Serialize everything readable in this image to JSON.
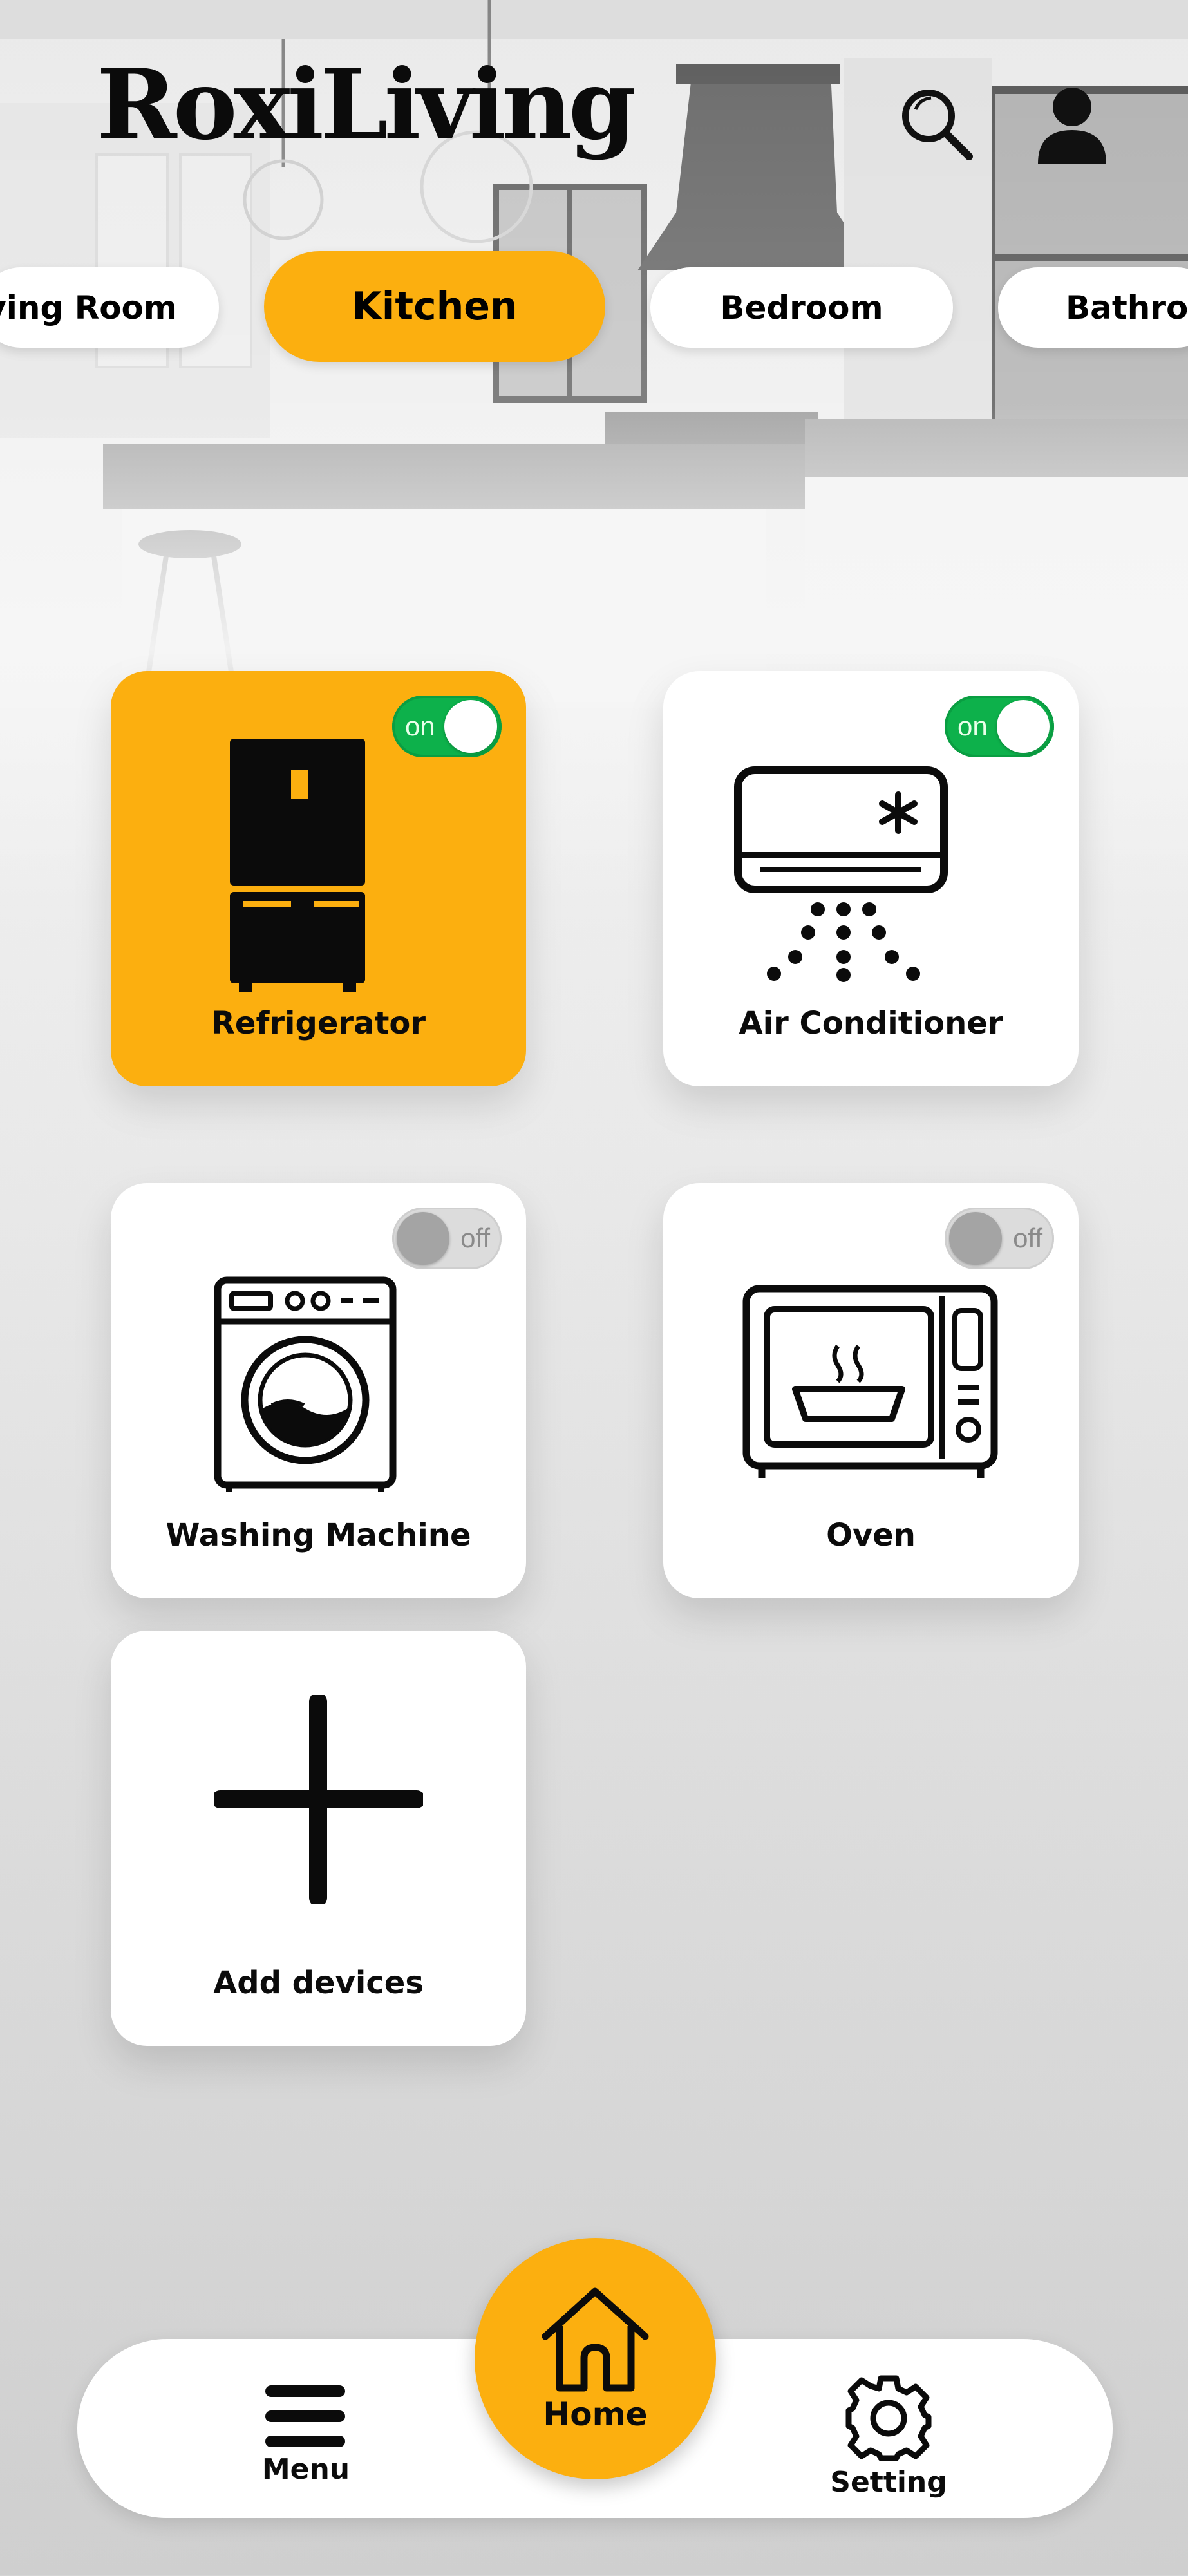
{
  "app": {
    "brand": "RoxiLiving"
  },
  "header": {
    "search_icon": "search-icon",
    "profile_icon": "user-icon"
  },
  "rooms": [
    {
      "label": "ving Room",
      "active": false
    },
    {
      "label": "Kitchen",
      "active": true
    },
    {
      "label": "Bedroom",
      "active": false
    },
    {
      "label": "Bathroo",
      "active": false
    }
  ],
  "devices": [
    {
      "label": "Refrigerator",
      "icon": "refrigerator-icon",
      "state": "on"
    },
    {
      "label": "Air Conditioner",
      "icon": "air-conditioner-icon",
      "state": "on"
    },
    {
      "label": "Washing Machine",
      "icon": "washing-machine-icon",
      "state": "off"
    },
    {
      "label": "Oven",
      "icon": "oven-icon",
      "state": "off"
    }
  ],
  "add_device": {
    "label": "Add devices",
    "icon": "plus-icon"
  },
  "nav": {
    "menu_label": "Menu",
    "home_label": "Home",
    "setting_label": "Setting"
  },
  "colors": {
    "accent": "#fcaf0f",
    "toggle_on": "#0db14b",
    "toggle_off": "#dcdcdc",
    "card": "#ffffff"
  }
}
